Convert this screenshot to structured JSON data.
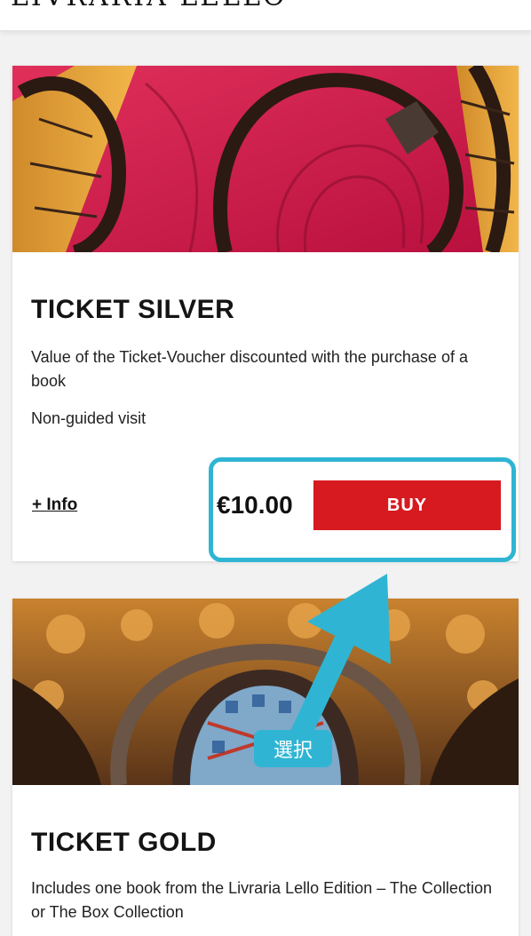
{
  "header": {
    "logo_text": "LIVRARIA LELLO"
  },
  "tickets": [
    {
      "title": "TICKET SILVER",
      "description": "Value of the Ticket-Voucher discounted with the purchase of a book",
      "visit_type": "Non-guided visit",
      "info_link": "+ Info",
      "price": "€10.00",
      "buy_label": "BUY"
    },
    {
      "title": "TICKET GOLD",
      "description": "Includes one book from the Livraria Lello Edition – The Collection or The Box Collection"
    }
  ],
  "annotation": {
    "label": "選択",
    "color": "#2fb5d3"
  },
  "colors": {
    "buy_button": "#d71920",
    "highlight": "#2fb5d3"
  }
}
